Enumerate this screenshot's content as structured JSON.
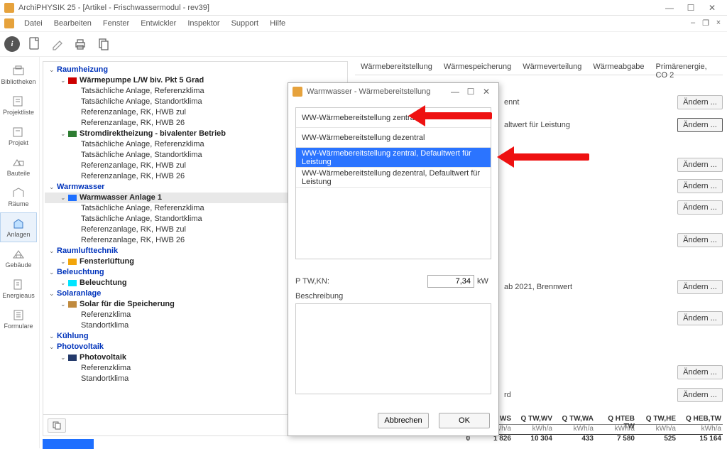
{
  "window": {
    "title": "ArchiPHYSIK 25 - [Artikel - Frischwassermodul - rev39]"
  },
  "menu": [
    "Datei",
    "Bearbeiten",
    "Fenster",
    "Entwickler",
    "Inspektor",
    "Support",
    "Hilfe"
  ],
  "sidebar": [
    {
      "label": "Bibliotheken"
    },
    {
      "label": "Projektliste"
    },
    {
      "label": "Projekt"
    },
    {
      "label": "Bauteile"
    },
    {
      "label": "Räume"
    },
    {
      "label": "Anlagen",
      "active": true
    },
    {
      "label": "Gebäude"
    },
    {
      "label": "Energieaus"
    },
    {
      "label": "Formulare"
    }
  ],
  "tree": {
    "sections": [
      {
        "title": "Raumheizung",
        "items": [
          {
            "bold": "Wärmepumpe L/W biv. Pkt 5 Grad",
            "sw": "#cc0000",
            "children": [
              "Tatsächliche Anlage, Referenzklima",
              "Tatsächliche Anlage, Standortklima",
              "Referenzanlage, RK, HWB zul",
              "Referenzanlage, RK, HWB 26"
            ]
          },
          {
            "bold": "Stromdirektheizung - bivalenter Betrieb",
            "sw": "#2e7d32",
            "children": [
              "Tatsächliche Anlage, Referenzklima",
              "Tatsächliche Anlage, Standortklima",
              "Referenzanlage, RK, HWB zul",
              "Referenzanlage, RK, HWB 26"
            ]
          }
        ]
      },
      {
        "title": "Warmwasser",
        "items": [
          {
            "bold": "Warmwasser Anlage 1",
            "sw": "#1e6fff",
            "selected": true,
            "children": [
              "Tatsächliche Anlage, Referenzklima",
              "Tatsächliche Anlage, Standortklima",
              "Referenzanlage, RK, HWB zul",
              "Referenzanlage, RK, HWB 26"
            ]
          }
        ]
      },
      {
        "title": "Raumlufttechnik",
        "items": [
          {
            "bold": "Fensterlüftung",
            "sw": "#f2a50a"
          }
        ]
      },
      {
        "title": "Beleuchtung",
        "items": [
          {
            "bold": "Beleuchtung",
            "sw": "#00e5ff"
          }
        ]
      },
      {
        "title": "Solaranlage",
        "items": [
          {
            "bold": "Solar für die Speicherung",
            "sw": "#c08a3e",
            "children": [
              "Referenzklima",
              "Standortklima"
            ]
          }
        ]
      },
      {
        "title": "Kühlung"
      },
      {
        "title": "Photovoltaik",
        "items": [
          {
            "bold": "Photovoltaik",
            "sw": "#243a6b",
            "children": [
              "Referenzklima",
              "Standortklima"
            ]
          }
        ]
      }
    ]
  },
  "right": {
    "tabs": [
      "Wärmebereitstellung",
      "Wärmespeicherung",
      "Wärmeverteilung",
      "Wärmeabgabe",
      "Primärenergie, CO 2"
    ],
    "rows": [
      {
        "label": "ennt"
      },
      {
        "label": "altwert für Leistung",
        "active": true
      },
      {
        "label": ""
      },
      {
        "label": ""
      },
      {
        "label": ""
      },
      {
        "label": ""
      },
      {
        "label": "ab 2021, Brennwert"
      },
      {
        "label": ""
      },
      {
        "label": ""
      },
      {
        "label": "rd"
      }
    ],
    "change_label": "Ändern ...",
    "table": {
      "headers": [
        "WS",
        "Q TW,WV",
        "Q TW,WA",
        "Q HTEB TW",
        "Q TW,HE",
        "Q HEB,TW"
      ],
      "units": [
        "kWh/a",
        "kWh/a",
        "kWh/a",
        "kWh/a",
        "kWh/a",
        "kWh/a"
      ],
      "values": [
        "0",
        "1 826",
        "10 304",
        "433",
        "7 580",
        "525",
        "15 164"
      ]
    }
  },
  "modal": {
    "title": "Warmwasser - Wärmebereitstellung",
    "items": [
      "WW-Wärmebereitstellung zentral",
      "WW-Wärmebereitstellung dezentral",
      "WW-Wärmebereitstellung zentral, Defaultwert für Leistung",
      "WW-Wärmebereitstellung dezentral, Defaultwert für Leistung"
    ],
    "selected_index": 2,
    "p_label": "P TW,KN:",
    "p_value": "7,34",
    "p_unit": "kW",
    "desc_label": "Beschreibung",
    "btn_cancel": "Abbrechen",
    "btn_ok": "OK"
  }
}
